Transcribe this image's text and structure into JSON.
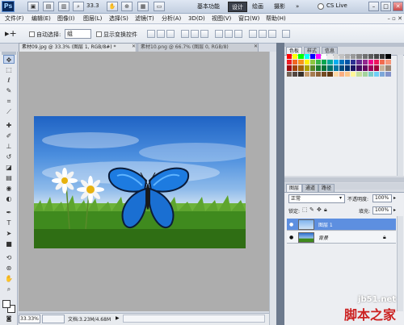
{
  "titlebar": {
    "app_logo": "Ps",
    "zoom": "33.3",
    "workspaces": [
      "基本功能",
      "设计",
      "绘画",
      "摄影"
    ],
    "active_workspace": "设计",
    "more": "»",
    "cs_live": "CS Live"
  },
  "menu": [
    "文件(F)",
    "编辑(E)",
    "图像(I)",
    "图层(L)",
    "选择(S)",
    "滤镜(T)",
    "分析(A)",
    "3D(D)",
    "视图(V)",
    "窗口(W)",
    "帮助(H)"
  ],
  "options": {
    "auto_select_label": "自动选择:",
    "auto_select_value": "组",
    "show_transform_label": "显示变换控件"
  },
  "doc_tabs": [
    {
      "label": "素材09.jpg @ 33.3% (图层 1, RGB/8#) *"
    },
    {
      "label": "素材10.png @ 66.7% (图层 0, RGB/8)"
    }
  ],
  "status": {
    "zoom": "33.33%",
    "doc_info": "文档:3.23M/4.68M"
  },
  "swatches_panel": {
    "tabs": [
      "色板",
      "样式",
      "信息"
    ],
    "colors": [
      "#ff0000",
      "#ffff00",
      "#00ff00",
      "#00ffff",
      "#0000ff",
      "#ff00ff",
      "#ffffff",
      "#ebebeb",
      "#d6d6d6",
      "#c2c2c2",
      "#adadad",
      "#999999",
      "#858585",
      "#707070",
      "#5c5c5c",
      "#474747",
      "#333333",
      "#000000",
      "#ee1d24",
      "#f16522",
      "#f7941d",
      "#fff200",
      "#8dc63f",
      "#39b54a",
      "#00a651",
      "#00a99d",
      "#00aeef",
      "#0072bc",
      "#0054a6",
      "#2e3192",
      "#662d91",
      "#92278f",
      "#ec008c",
      "#ed145b",
      "#f26c4f",
      "#f69679",
      "#9e0b0f",
      "#a0410d",
      "#a36209",
      "#aba000",
      "#598527",
      "#1a7b30",
      "#007236",
      "#00746b",
      "#0076a3",
      "#004b80",
      "#003471",
      "#1b1464",
      "#440e62",
      "#630460",
      "#9e005d",
      "#9e0039",
      "#c7b299",
      "#998675",
      "#736357",
      "#534741",
      "#37302a",
      "#c69c6d",
      "#a67c52",
      "#8c6239",
      "#754c24",
      "#603913",
      "#ffd9a6",
      "#f9ad81",
      "#fdc689",
      "#fff799",
      "#c4df9b",
      "#a3d39c",
      "#7accc8",
      "#6dcff6",
      "#7da7d9",
      "#8393ca"
    ]
  },
  "layers_panel": {
    "tabs": [
      "图层",
      "通道",
      "路径"
    ],
    "blend_mode": "正常",
    "opacity_label": "不透明度:",
    "opacity_value": "100%",
    "lock_label": "锁定:",
    "fill_label": "填充:",
    "fill_value": "100%",
    "layers": [
      {
        "name": "图层 1",
        "selected": true
      },
      {
        "name": "背景",
        "selected": false
      }
    ]
  },
  "watermark": {
    "url": "jb51.net",
    "cn": "脚本之家"
  }
}
